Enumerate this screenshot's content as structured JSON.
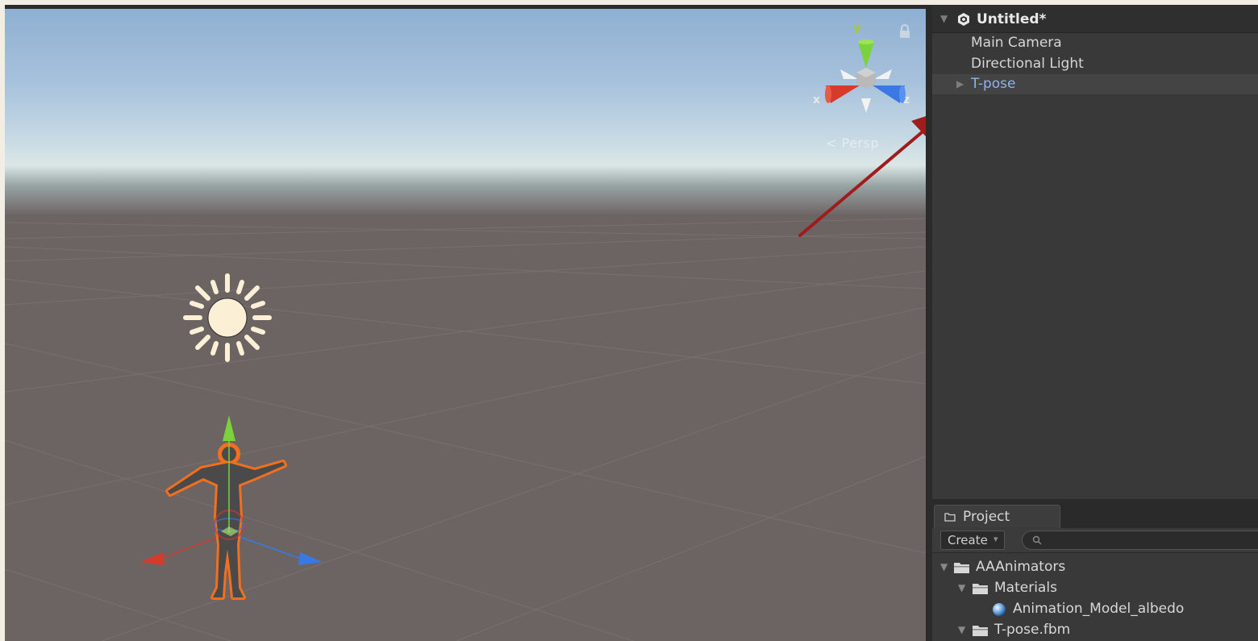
{
  "scene_view": {
    "gizmo_axes": {
      "x": "x",
      "y": "y",
      "z": "z"
    },
    "projection_label": "< Persp",
    "icons": [
      "lock-icon",
      "axis-gizmo-icon",
      "directional-light-sun-icon",
      "move-tool-gizmo-icon"
    ],
    "colors": {
      "x_axis": "#d63a2a",
      "y_axis": "#7ad33a",
      "z_axis": "#3a78e6",
      "selection_outline": "#f07020"
    }
  },
  "hierarchy": {
    "scene_name": "Untitled*",
    "items": [
      {
        "label": "Main Camera"
      },
      {
        "label": "Directional Light"
      },
      {
        "label": "T-pose",
        "selected": true
      }
    ]
  },
  "annotation": {
    "arrow_color": "#a01c1c"
  },
  "project": {
    "tab_label": "Project",
    "create_label": "Create",
    "search_placeholder": "",
    "tree": [
      {
        "label": "AAAnimators",
        "type": "folder",
        "expanded": true
      },
      {
        "label": "Materials",
        "type": "folder",
        "expanded": true
      },
      {
        "label": "Animation_Model_albedo",
        "type": "material"
      },
      {
        "label": "T-pose.fbm",
        "type": "folder",
        "expanded": true
      }
    ]
  }
}
